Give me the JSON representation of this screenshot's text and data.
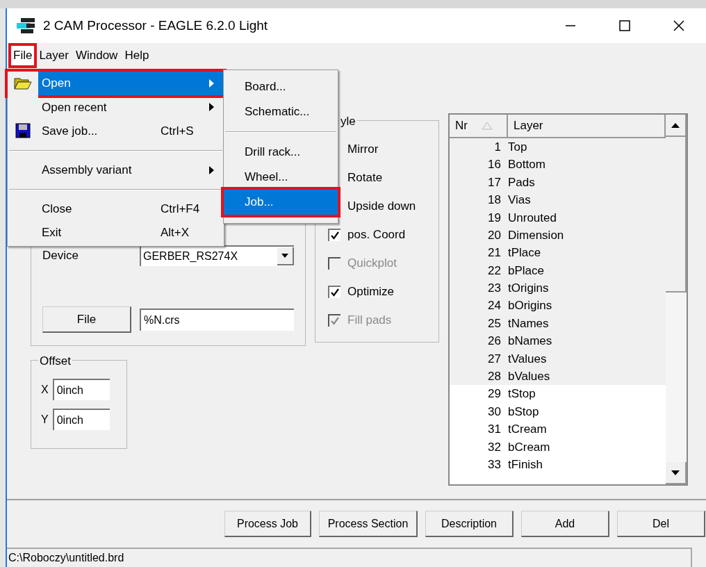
{
  "window": {
    "title": "2 CAM Processor - EAGLE 6.2.0 Light"
  },
  "menubar": [
    {
      "label": "File",
      "open": true,
      "annotated": true
    },
    {
      "label": "Layer",
      "open": false,
      "annotated": false
    },
    {
      "label": "Window",
      "open": false,
      "annotated": false
    },
    {
      "label": "Help",
      "open": false,
      "annotated": false
    }
  ],
  "file_menu": [
    {
      "kind": "item",
      "label": "Open",
      "submenu": true,
      "highlighted": true,
      "annotated": true
    },
    {
      "kind": "item",
      "label": "Open recent",
      "submenu": true,
      "highlighted": false,
      "annotated": false
    },
    {
      "kind": "item",
      "label": "Save job...",
      "shortcut": "Ctrl+S",
      "submenu": false,
      "highlighted": false,
      "annotated": false
    },
    {
      "kind": "separator"
    },
    {
      "kind": "item",
      "label": "Assembly variant",
      "submenu": true,
      "highlighted": false,
      "annotated": false
    },
    {
      "kind": "separator"
    },
    {
      "kind": "item",
      "label": "Close",
      "shortcut": "Ctrl+F4",
      "submenu": false,
      "highlighted": false,
      "annotated": false
    },
    {
      "kind": "item",
      "label": "Exit",
      "shortcut": "Alt+X",
      "submenu": false,
      "highlighted": false,
      "annotated": false
    }
  ],
  "open_submenu": [
    {
      "kind": "item",
      "label": "Board...",
      "highlighted": false,
      "annotated": false
    },
    {
      "kind": "item",
      "label": "Schematic...",
      "highlighted": false,
      "annotated": false
    },
    {
      "kind": "separator"
    },
    {
      "kind": "item",
      "label": "Drill rack...",
      "highlighted": false,
      "annotated": false
    },
    {
      "kind": "item",
      "label": "Wheel...",
      "highlighted": false,
      "annotated": false
    },
    {
      "kind": "item",
      "label": "Job...",
      "highlighted": true,
      "annotated": true
    }
  ],
  "output": {
    "device_label": "Device",
    "device_value": "GERBER_RS274X",
    "file_button": "File",
    "file_value": "%N.crs"
  },
  "offset": {
    "title": "Offset",
    "fields": [
      {
        "label": "X",
        "value": "0inch"
      },
      {
        "label": "Y",
        "value": "0inch"
      }
    ]
  },
  "style": {
    "title": "yle",
    "options": [
      {
        "kind": "covered",
        "label": "Mirror"
      },
      {
        "kind": "covered",
        "label": "Rotate"
      },
      {
        "kind": "covered",
        "label": "Upside down"
      },
      {
        "kind": "checkbox",
        "label": "pos. Coord",
        "checked": true,
        "disabled": false
      },
      {
        "kind": "checkbox",
        "label": "Quickplot",
        "checked": false,
        "disabled": true
      },
      {
        "kind": "checkbox",
        "label": "Optimize",
        "checked": true,
        "disabled": false
      },
      {
        "kind": "checkbox",
        "label": "Fill pads",
        "checked": true,
        "disabled": true
      }
    ]
  },
  "layer_list": {
    "columns": [
      {
        "label": "Nr",
        "sorted": true
      },
      {
        "label": "Layer",
        "sorted": false
      }
    ],
    "rows": [
      {
        "nr": "1",
        "name": "Top",
        "selected": true
      },
      {
        "nr": "16",
        "name": "Bottom",
        "selected": true
      },
      {
        "nr": "17",
        "name": "Pads",
        "selected": true
      },
      {
        "nr": "18",
        "name": "Vias",
        "selected": true
      },
      {
        "nr": "19",
        "name": "Unrouted",
        "selected": true
      },
      {
        "nr": "20",
        "name": "Dimension",
        "selected": true
      },
      {
        "nr": "21",
        "name": "tPlace",
        "selected": true
      },
      {
        "nr": "22",
        "name": "bPlace",
        "selected": true
      },
      {
        "nr": "23",
        "name": "tOrigins",
        "selected": true
      },
      {
        "nr": "24",
        "name": "bOrigins",
        "selected": true
      },
      {
        "nr": "25",
        "name": "tNames",
        "selected": true
      },
      {
        "nr": "26",
        "name": "bNames",
        "selected": true
      },
      {
        "nr": "27",
        "name": "tValues",
        "selected": true
      },
      {
        "nr": "28",
        "name": "bValues",
        "selected": true
      },
      {
        "nr": "29",
        "name": "tStop",
        "selected": false
      },
      {
        "nr": "30",
        "name": "bStop",
        "selected": false
      },
      {
        "nr": "31",
        "name": "tCream",
        "selected": false
      },
      {
        "nr": "32",
        "name": "bCream",
        "selected": false
      },
      {
        "nr": "33",
        "name": "tFinish",
        "selected": false
      }
    ]
  },
  "buttons": [
    "Process Job",
    "Process Section",
    "Description",
    "Add",
    "Del"
  ],
  "status_bar": {
    "text": "C:\\Roboczy\\untitled.brd"
  }
}
